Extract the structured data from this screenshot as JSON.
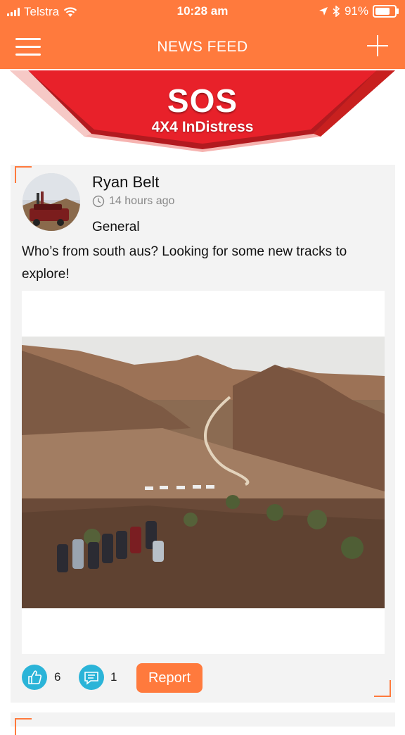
{
  "status_bar": {
    "carrier": "Telstra",
    "time": "10:28 am",
    "battery": "91%",
    "battery_level": 0.91,
    "icons": [
      "signal-icon",
      "wifi-icon",
      "location-arrow-icon",
      "bluetooth-icon",
      "battery-icon"
    ]
  },
  "nav": {
    "title": "NEWS FEED",
    "menu_icon": "hamburger-menu-icon",
    "add_icon": "plus-icon"
  },
  "banner": {
    "title": "SOS",
    "tagline": "4X4 InDistress",
    "colors": {
      "red": "#e8212a",
      "shadow": "#b21a1f",
      "pink": "#f6b3b0"
    }
  },
  "post": {
    "author": "Ryan Belt",
    "time_ago": "14 hours ago",
    "category": "General",
    "body": "Who’s from south aus? Looking for some new tracks to explore!",
    "likes": "6",
    "comments": "1",
    "report_label": "Report"
  },
  "colors": {
    "accent": "#ff7a3d",
    "action_blue": "#2bb4d8",
    "card_bg": "#f3f3f3"
  }
}
